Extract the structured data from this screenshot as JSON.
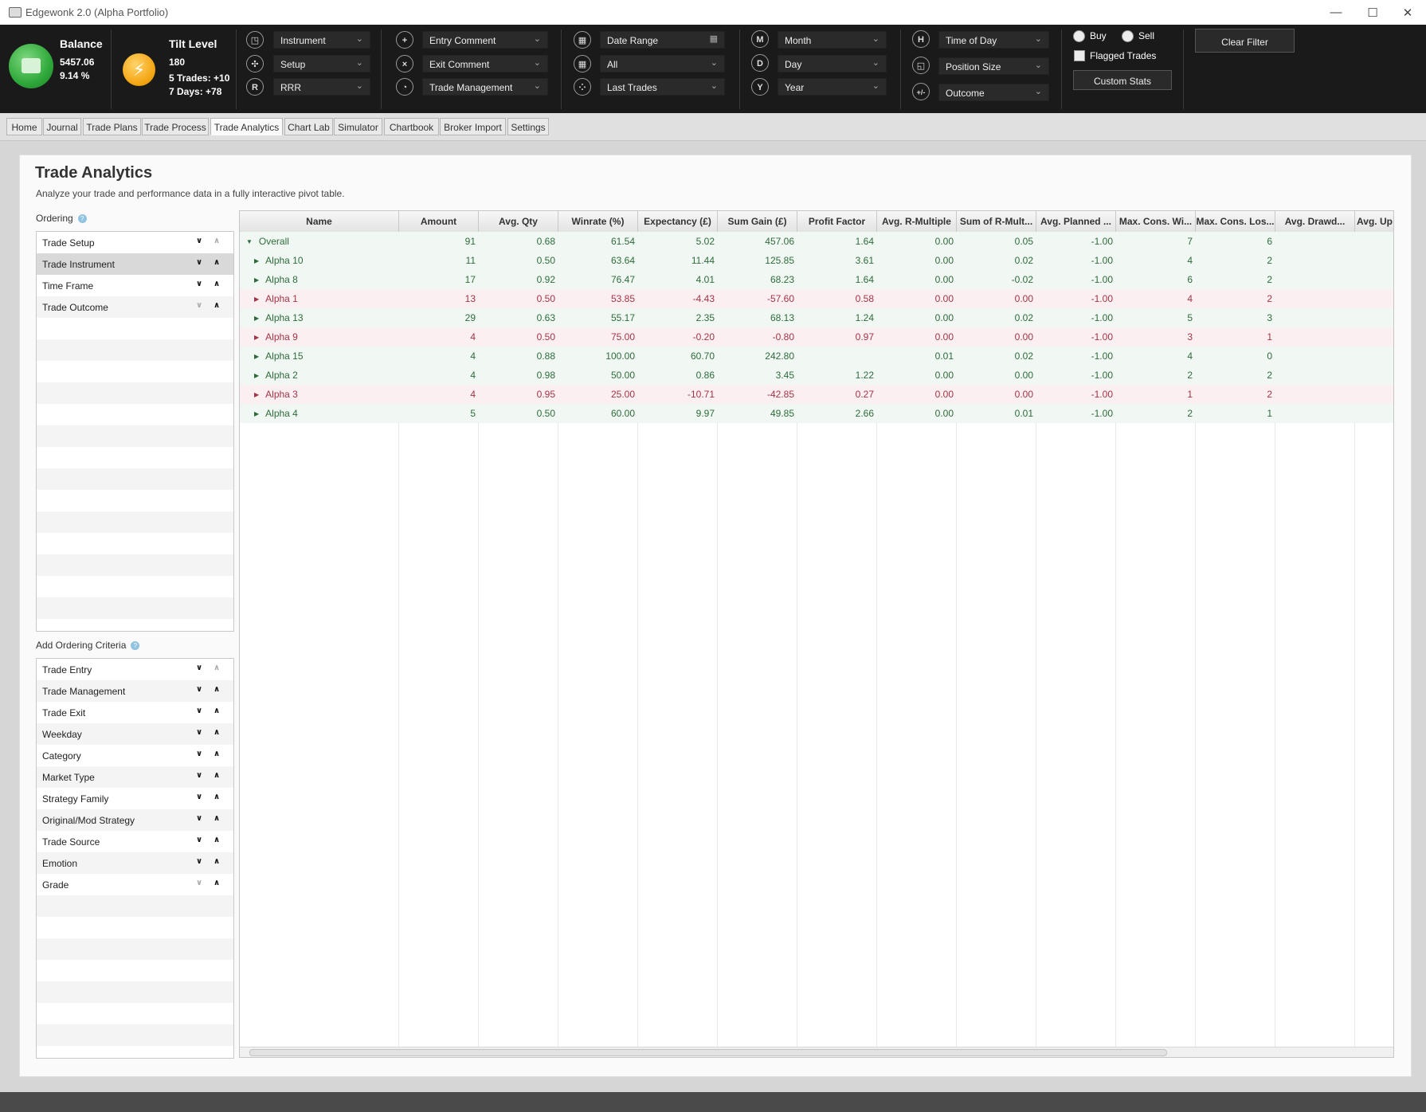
{
  "window": {
    "title": "Edgewonk 2.0 (Alpha Portfolio)",
    "minimize": "—",
    "maximize": "☐",
    "close": "✕"
  },
  "toolbar": {
    "balance": {
      "label": "Balance",
      "value": "5457.06",
      "percent": "9.14 %"
    },
    "tilt": {
      "label": "Tilt Level",
      "value": "180",
      "trades": "5 Trades: +10",
      "days": "7 Days: +78"
    },
    "filters_col1": [
      {
        "icon": "instrument-icon",
        "label": "Instrument"
      },
      {
        "icon": "setup-icon",
        "label": "Setup"
      },
      {
        "icon": "R",
        "label": "RRR"
      }
    ],
    "filters_col2": [
      {
        "icon": "entry-comment-icon",
        "label": "Entry Comment"
      },
      {
        "icon": "exit-comment-icon",
        "label": "Exit Comment"
      },
      {
        "icon": "trade-management-icon",
        "label": "Trade Management"
      }
    ],
    "filters_col3": [
      {
        "icon": "calendar-icon",
        "label": "Date Range"
      },
      {
        "icon": "calendar-icon",
        "label": "All"
      },
      {
        "icon": "last-trades-icon",
        "label": "Last Trades"
      }
    ],
    "filters_col4": [
      {
        "icon": "M",
        "label": "Month"
      },
      {
        "icon": "D",
        "label": "Day"
      },
      {
        "icon": "Y",
        "label": "Year"
      }
    ],
    "filters_col5": [
      {
        "icon": "H",
        "label": "Time of Day"
      },
      {
        "icon": "position-size-icon",
        "label": "Position Size"
      },
      {
        "icon": "+/-",
        "label": "Outcome"
      }
    ],
    "buy_label": "Buy",
    "sell_label": "Sell",
    "flagged_label": "Flagged Trades",
    "custom_stats": "Custom Stats",
    "clear_filter": "Clear Filter"
  },
  "tabs": [
    "Home",
    "Journal",
    "Trade Plans",
    "Trade Process",
    "Trade Analytics",
    "Chart Lab",
    "Simulator",
    "Chartbook",
    "Broker Import",
    "Settings"
  ],
  "active_tab": "Trade Analytics",
  "page": {
    "title": "Trade Analytics",
    "subtitle": "Analyze your trade and performance data in a fully interactive pivot table."
  },
  "ordering": {
    "label": "Ordering",
    "items": [
      "Trade Setup",
      "Trade Instrument",
      "Time Frame",
      "Trade Outcome"
    ],
    "selected": "Trade Instrument"
  },
  "criteria": {
    "label": "Add Ordering Criteria",
    "items": [
      "Trade Entry",
      "Trade Management",
      "Trade Exit",
      "Weekday",
      "Category",
      "Market Type",
      "Strategy Family",
      "Original/Mod Strategy",
      "Trade Source",
      "Emotion",
      "Grade"
    ]
  },
  "table": {
    "columns": [
      "Name",
      "Amount",
      "Avg. Qty",
      "Winrate (%)",
      "Expectancy (£)",
      "Sum Gain (£)",
      "Profit Factor",
      "Avg. R-Multiple",
      "Sum of R-Mult...",
      "Avg. Planned ...",
      "Max. Cons. Wi...",
      "Max. Cons. Los...",
      "Avg. Drawd...",
      "Avg. Up"
    ],
    "rows": [
      {
        "name": "Overall",
        "expanded": true,
        "status": "positive",
        "cells": [
          "91",
          "0.68",
          "61.54",
          "5.02",
          "457.06",
          "1.64",
          "0.00",
          "0.05",
          "-1.00",
          "7",
          "6",
          "",
          ""
        ]
      },
      {
        "name": "Alpha 10",
        "status": "positive",
        "cells": [
          "11",
          "0.50",
          "63.64",
          "11.44",
          "125.85",
          "3.61",
          "0.00",
          "0.02",
          "-1.00",
          "4",
          "2",
          "",
          ""
        ]
      },
      {
        "name": "Alpha 8",
        "status": "positive",
        "cells": [
          "17",
          "0.92",
          "76.47",
          "4.01",
          "68.23",
          "1.64",
          "0.00",
          "-0.02",
          "-1.00",
          "6",
          "2",
          "",
          ""
        ]
      },
      {
        "name": "Alpha 1",
        "status": "negative",
        "cells": [
          "13",
          "0.50",
          "53.85",
          "-4.43",
          "-57.60",
          "0.58",
          "0.00",
          "0.00",
          "-1.00",
          "4",
          "2",
          "",
          ""
        ]
      },
      {
        "name": "Alpha 13",
        "status": "positive",
        "cells": [
          "29",
          "0.63",
          "55.17",
          "2.35",
          "68.13",
          "1.24",
          "0.00",
          "0.02",
          "-1.00",
          "5",
          "3",
          "",
          ""
        ]
      },
      {
        "name": "Alpha 9",
        "status": "negative",
        "cells": [
          "4",
          "0.50",
          "75.00",
          "-0.20",
          "-0.80",
          "0.97",
          "0.00",
          "0.00",
          "-1.00",
          "3",
          "1",
          "",
          ""
        ]
      },
      {
        "name": "Alpha 15",
        "status": "positive",
        "cells": [
          "4",
          "0.88",
          "100.00",
          "60.70",
          "242.80",
          "",
          "0.01",
          "0.02",
          "-1.00",
          "4",
          "0",
          "",
          ""
        ]
      },
      {
        "name": "Alpha 2",
        "status": "positive",
        "cells": [
          "4",
          "0.98",
          "50.00",
          "0.86",
          "3.45",
          "1.22",
          "0.00",
          "0.00",
          "-1.00",
          "2",
          "2",
          "",
          ""
        ]
      },
      {
        "name": "Alpha 3",
        "status": "negative",
        "cells": [
          "4",
          "0.95",
          "25.00",
          "-10.71",
          "-42.85",
          "0.27",
          "0.00",
          "0.00",
          "-1.00",
          "1",
          "2",
          "",
          ""
        ]
      },
      {
        "name": "Alpha 4",
        "status": "positive",
        "cells": [
          "5",
          "0.50",
          "60.00",
          "9.97",
          "49.85",
          "2.66",
          "0.00",
          "0.01",
          "-1.00",
          "2",
          "1",
          "",
          ""
        ]
      }
    ]
  },
  "colors": {
    "positive_text": "#2e6b3b",
    "negative_text": "#a23448",
    "toolbar_bg": "#1a1a1a",
    "balance_green": "#2fa83a",
    "tilt_orange": "#f4a513"
  }
}
